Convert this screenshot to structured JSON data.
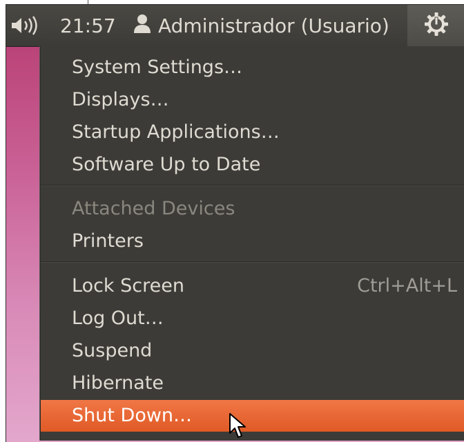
{
  "panel": {
    "sound_icon": "speaker-volume-icon",
    "clock": "21:57",
    "user_icon": "person-icon",
    "user_name": "Administrador (Usuario)",
    "session_icon": "power-gear-icon"
  },
  "menu": {
    "group1": [
      {
        "label": "System Settings…"
      },
      {
        "label": "Displays…"
      },
      {
        "label": "Startup Applications…"
      },
      {
        "label": "Software Up to Date"
      }
    ],
    "group2": [
      {
        "label": "Attached Devices",
        "disabled": true
      },
      {
        "label": "Printers"
      }
    ],
    "group3": [
      {
        "label": "Lock Screen",
        "shortcut": "Ctrl+Alt+L"
      },
      {
        "label": "Log Out…"
      },
      {
        "label": "Suspend"
      },
      {
        "label": "Hibernate"
      },
      {
        "label": "Shut Down…",
        "highlighted": true
      }
    ]
  },
  "colors": {
    "panel_bg": "#3c3b37",
    "menu_bg": "#3c3b37",
    "highlight": "#e8652f",
    "text": "#dfdbd2",
    "disabled_text": "#8a877f",
    "desktop": "#c85e93"
  }
}
